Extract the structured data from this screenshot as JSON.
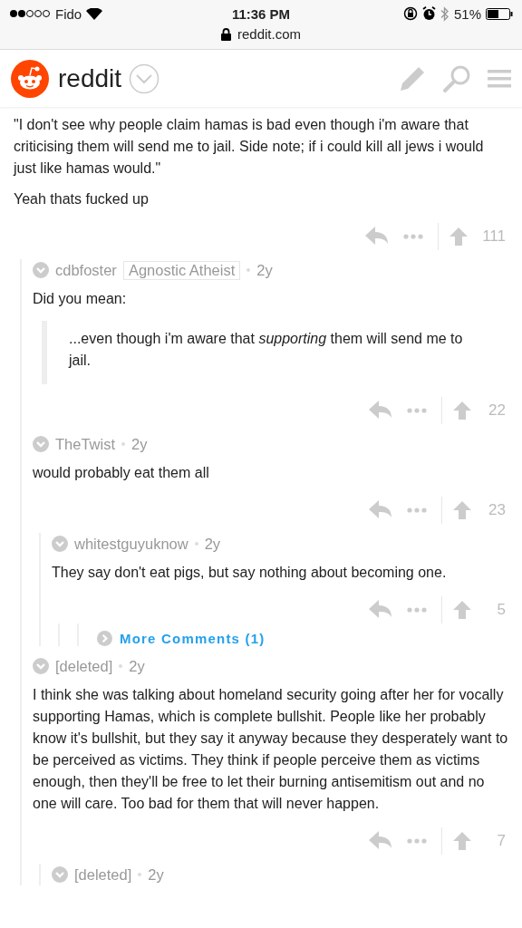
{
  "status_bar": {
    "carrier": "Fido",
    "time": "11:36 PM",
    "battery": "51%",
    "url": "reddit.com"
  },
  "nav": {
    "logo_text": "reddit"
  },
  "comment": {
    "body": [
      "\"I don't see why people claim hamas is bad even though i'm aware that criticising them will send me to jail. Side note; if i could kill all jews i would just like hamas would.\"",
      "Yeah thats fucked up"
    ],
    "score": "111",
    "children": [
      {
        "author": "cdbfoster",
        "flair": "Agnostic Atheist",
        "age": "2y",
        "body": [
          "Did you mean:"
        ],
        "quote": "...even though i'm aware that *supporting* them will send me to jail.",
        "score": "22"
      },
      {
        "author": "TheTwist",
        "age": "2y",
        "body": [
          "would probably eat them all"
        ],
        "score": "23",
        "children": [
          {
            "author": "whitestguyuknow",
            "age": "2y",
            "body": [
              "They say don't eat pigs, but say nothing about becoming one."
            ],
            "score": "5",
            "more": "More Comments (1)"
          }
        ]
      },
      {
        "author": "[deleted]",
        "age": "2y",
        "body": [
          "I think she was talking about homeland security going after her for vocally supporting Hamas, which is complete bullshit. People like her probably know it's bullshit, but they say it anyway because they desperately want to be perceived as victims. They think if people perceive them as victims enough, then they'll be free to let their burning antisemitism out and no one will care. Too bad for them that will never happen."
        ],
        "score": "7",
        "children": [
          {
            "author": "[deleted]",
            "age": "2y"
          }
        ]
      }
    ]
  }
}
